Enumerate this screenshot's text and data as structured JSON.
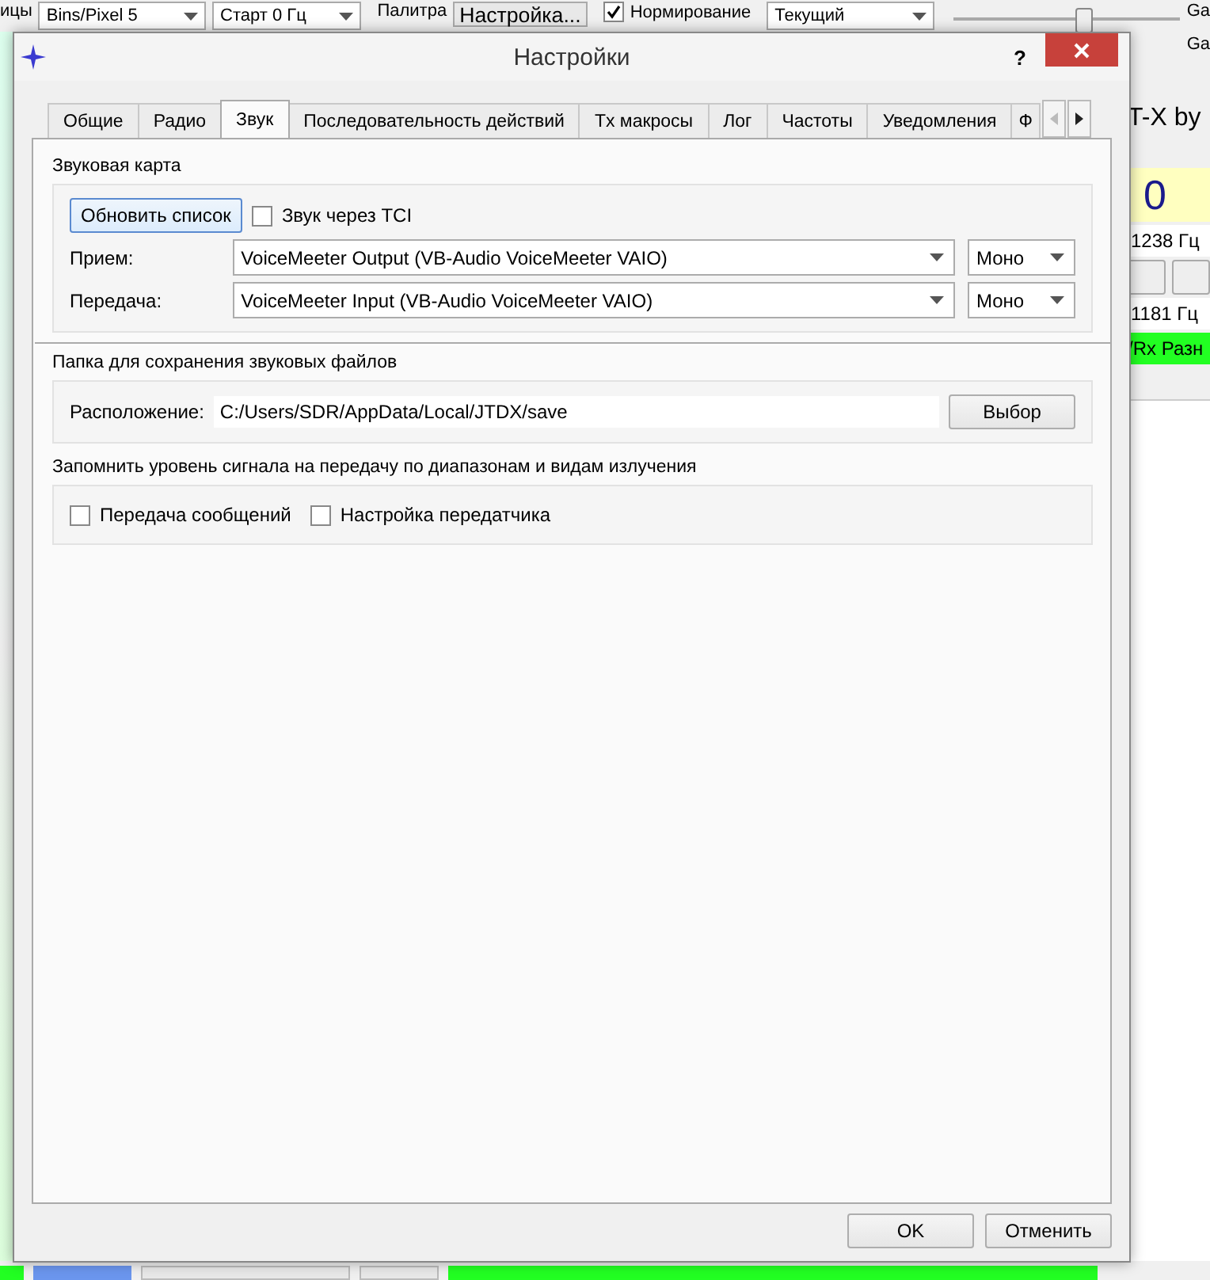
{
  "background_app": {
    "top_bar": {
      "label": "ицы",
      "bins": "Bins/Pixel  5",
      "start": "Старт 0 Гц",
      "palette_label": "Палитра",
      "palette_button": "Настройка...",
      "normalize": {
        "label": "Нормирование",
        "checked": true
      },
      "mode": "Текущий",
      "slider": {
        "level": 0.55
      },
      "gain_labels": [
        "Ga",
        "Ga"
      ]
    },
    "right_panel": {
      "title": "T-X by",
      "display": "0",
      "rx_freq": "1238  Гц",
      "tx_freq": "1181  Гц",
      "status": "/Rx Разн"
    }
  },
  "dialog": {
    "title": "Настройки",
    "help": "?",
    "tabs": [
      {
        "label": "Общие",
        "selected": false
      },
      {
        "label": "Радио",
        "selected": false
      },
      {
        "label": "Звук",
        "selected": true
      },
      {
        "label": "Последовательность действий",
        "selected": false
      },
      {
        "label": "Tx макросы",
        "selected": false
      },
      {
        "label": "Лог",
        "selected": false
      },
      {
        "label": "Частоты",
        "selected": false
      },
      {
        "label": "Уведомления",
        "selected": false
      },
      {
        "label": "Ф",
        "selected": false
      }
    ],
    "sound_card": {
      "title": "Звуковая карта",
      "refresh_button": "Обновить список",
      "tci": {
        "label": "Звук через TCI",
        "checked": false
      },
      "devices": [
        {
          "label": "Прием:",
          "device": "VoiceMeeter Output (VB-Audio VoiceMeeter VAIO)",
          "channel": "Моно"
        },
        {
          "label": "Передача:",
          "device": "VoiceMeeter Input (VB-Audio VoiceMeeter VAIO)",
          "channel": "Моно"
        }
      ]
    },
    "save_folder": {
      "title": "Папка для сохранения звуковых файлов",
      "label": "Расположение:",
      "path": "C:/Users/SDR/AppData/Local/JTDX/save",
      "button": "Выбор"
    },
    "remember_level": {
      "title": "Запомнить уровень сигнала на передачу по диапазонам и видам излучения",
      "options": [
        {
          "label": "Передача сообщений",
          "checked": false
        },
        {
          "label": "Настройка передатчика",
          "checked": false
        }
      ]
    },
    "buttons": [
      "OK",
      "Отменить"
    ]
  }
}
